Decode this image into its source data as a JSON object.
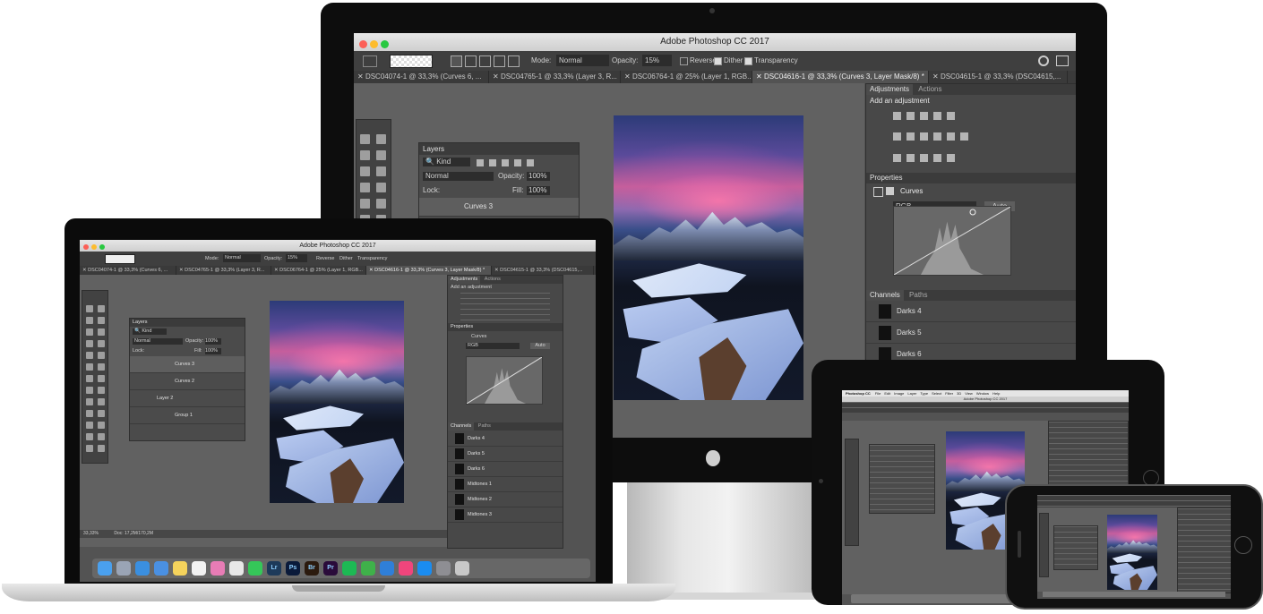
{
  "app": {
    "title": "Adobe Photoshop CC 2017"
  },
  "options_bar": {
    "mode_label": "Mode:",
    "mode_value": "Normal",
    "opacity_label": "Opacity:",
    "opacity_value": "15%",
    "reverse_label": "Reverse",
    "dither_label": "Dither",
    "transparency_label": "Transparency"
  },
  "document_tabs": [
    {
      "label": "DSC04074-1 @ 33,3% (Curves 6, ..."
    },
    {
      "label": "DSC04765-1 @ 33,3% (Layer 3, R..."
    },
    {
      "label": "DSC06764-1 @ 25% (Layer 1, RGB..."
    },
    {
      "label": "DSC04616-1 @ 33,3% (Curves 3, Layer Mask/8) *"
    },
    {
      "label": "DSC04615-1 @ 33,3% (DSC04615,..."
    }
  ],
  "layers_panel": {
    "title": "Layers",
    "kind": "Kind",
    "blend": "Normal",
    "opacity_label": "Opacity:",
    "opacity_value": "100%",
    "lock_label": "Lock:",
    "fill_label": "Fill:",
    "fill_value": "100%",
    "layers": [
      {
        "name": "Curves 3"
      },
      {
        "name": "Curves 2"
      },
      {
        "name": "Layer 2"
      },
      {
        "name": "Group 1"
      }
    ]
  },
  "adjustments_panel": {
    "tab_adjustments": "Adjustments",
    "tab_actions": "Actions",
    "subtitle": "Add an adjustment"
  },
  "properties_panel": {
    "title": "Properties",
    "layer_type": "Curves",
    "channel": "RGB",
    "auto_label": "Auto"
  },
  "channels_panel": {
    "tab_channels": "Channels",
    "tab_paths": "Paths",
    "channels": [
      {
        "name": "Darks 4"
      },
      {
        "name": "Darks 5"
      },
      {
        "name": "Darks 6"
      },
      {
        "name": "Midtones 1"
      },
      {
        "name": "Midtones 2"
      },
      {
        "name": "Midtones 3"
      }
    ]
  },
  "status_bar": {
    "zoom": "33,33%",
    "doc": "Doc: 17,2M/170,2M"
  },
  "ipad_menu": {
    "app": "Photoshop CC",
    "items": [
      "File",
      "Edit",
      "Image",
      "Layer",
      "Type",
      "Select",
      "Filter",
      "3D",
      "View",
      "Window",
      "Help"
    ]
  },
  "dock_icons": [
    "finder-icon",
    "launchpad-icon",
    "safari-icon",
    "mail-icon",
    "notes-icon",
    "calendar-icon",
    "photos-icon",
    "chrome-icon",
    "messages-icon",
    "lightroom-icon",
    "photoshop-icon",
    "bridge-icon",
    "premiere-icon",
    "spotify-icon",
    "numbers-icon",
    "keynote-icon",
    "itunes-icon",
    "appstore-icon",
    "preferences-icon",
    "trash-icon"
  ],
  "dock_labels": {
    "lightroom": "Lr",
    "photoshop": "Ps",
    "bridge": "Br",
    "premiere": "Pr"
  },
  "colors": {
    "ui_bg": "#535353",
    "panel": "#4b4b4b",
    "canvas": "#616161",
    "accent": "#2e63c5"
  }
}
